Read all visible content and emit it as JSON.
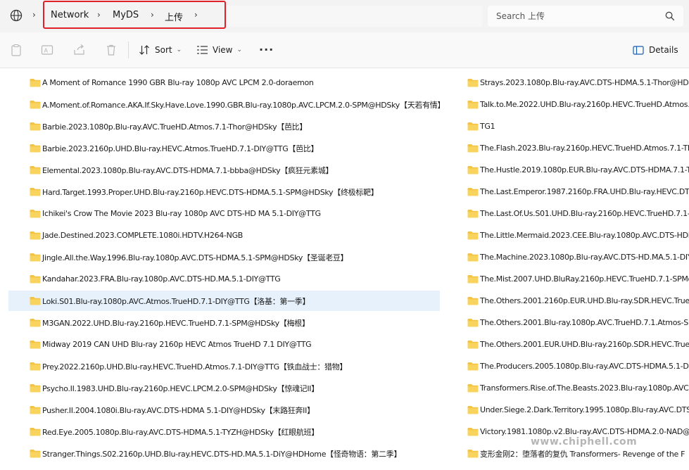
{
  "address_bar": {
    "breadcrumbs": [
      "Network",
      "MyDS",
      "上传"
    ]
  },
  "search": {
    "placeholder": "Search 上传"
  },
  "toolbar": {
    "sort_label": "Sort",
    "view_label": "View",
    "more_label": "···",
    "details_label": "Details"
  },
  "colors": {
    "folder": "#f4c342",
    "selection": "#e6f1fb",
    "highlight_border": "#e0202a"
  },
  "files_left": [
    "A Moment of Romance 1990 GBR Blu-ray 1080p AVC LPCM 2.0-doraemon",
    "A.Moment.of.Romance.AKA.If.Sky.Have.Love.1990.GBR.Blu-ray.1080p.AVC.LPCM.2.0-SPM@HDSky【天若有情】",
    "Barbie.2023.1080p.Blu-ray.AVC.TrueHD.Atmos.7.1-Thor@HDSky【芭比】",
    "Barbie.2023.2160p.UHD.Blu-ray.HEVC.Atmos.TrueHD.7.1-DIY@TTG【芭比】",
    "Elemental.2023.1080p.Blu-ray.AVC.DTS-HDMA.7.1-bbba@HDSky【疯狂元素城】",
    "Hard.Target.1993.Proper.UHD.Blu-ray.2160p.HEVC.DTS-HDMA.5.1-SPM@HDSky【终极标靶】",
    "Ichikei's Crow The Movie 2023 Blu-ray 1080p AVC DTS-HD MA 5.1-DIY@TTG",
    "Jade.Destined.2023.COMPLETE.1080i.HDTV.H264-NGB",
    "Jingle.All.the.Way.1996.Blu-ray.1080p.AVC.DTS-HDMA.5.1-SPM@HDSky【圣诞老豆】",
    "Kandahar.2023.FRA.Blu-ray.1080p.AVC.DTS-HD.MA.5.1-DIY@TTG",
    "Loki.S01.Blu-ray.1080p.AVC.Atmos.TrueHD.7.1-DIY@TTG【洛基：第一季】",
    "M3GAN.2022.UHD.Blu-ray.2160p.HEVC.TrueHD.7.1-SPM@HDSky【梅根】",
    "Midway 2019 CAN UHD Blu-ray 2160p HEVC Atmos TrueHD 7.1 DIY@TTG",
    "Prey.2022.2160p.UHD.Blu-ray.HEVC.TrueHD.Atmos.7.1-DIY@TTG【铁血战士：猎物】",
    "Psycho.II.1983.UHD.Blu-ray.2160p.HEVC.LPCM.2.0-SPM@HDSky【惊魂记II】",
    "Pusher.II.2004.1080i.Blu-ray.AVC.DTS-HDMA 5.1-DIY@HDSky【末路狂奔II】",
    "Red.Eye.2005.1080p.Blu-ray.AVC.DTS-HDMA.5.1-TYZH@HDSky【红眼航班】",
    "Stranger.Things.S02.2160p.UHD.Blu-ray.HEVC.DTS-HD.MA.5.1-DiY@HDHome【怪奇物语：第二季】"
  ],
  "files_right": [
    "Strays.2023.1080p.Blu-ray.AVC.DTS-HDMA.5.1-Thor@HDSky",
    "Talk.to.Me.2022.UHD.Blu-ray.2160p.HEVC.TrueHD.Atmos.7.1-",
    "TG1",
    "The.Flash.2023.Blu-ray.2160p.HEVC.TrueHD.Atmos.7.1-THDB",
    "The.Hustle.2019.1080p.EUR.Blu-ray.AVC.DTS-HDMA.7.1-TYZH",
    "The.Last.Emperor.1987.2160p.FRA.UHD.Blu-ray.HEVC.DTS-HD",
    "The.Last.Of.Us.S01.UHD.Blu-ray.2160p.HEVC.TrueHD.7.1-SPM",
    "The.Little.Mermaid.2023.CEE.Blu-ray.1080p.AVC.DTS-HDMA.7",
    "The.Machine.2023.1080p.Blu-ray.AVC.DTS-HD.MA.5.1-DIY@TT",
    "The.Mist.2007.UHD.BluRay.2160p.HEVC.TrueHD.7.1-SPM@HD",
    "The.Others.2001.2160p.EUR.UHD.Blu-ray.SDR.HEVC.TrueHD.A",
    "The.Others.2001.Blu-ray.1080p.AVC.TrueHD.7.1.Atmos-SPM@",
    "The.Others.2001.EUR.UHD.Blu-ray.2160p.SDR.HEVC.TrueHD.A",
    "The.Producers.2005.1080p.Blu-ray.AVC.DTS-HDMA.5.1-DIY@T",
    "Transformers.Rise.of.The.Beasts.2023.Blu-ray.1080p.AVC.True",
    "Under.Siege.2.Dark.Territory.1995.1080p.Blu-ray.AVC.DTS-HD",
    "Victory.1981.1080p.v2.Blu-ray.AVC.DTS-HDMA.2.0-NAD@HD",
    "变形金刚2：堕落者的复仇 Transformers- Revenge of the F"
  ],
  "selected_index_left": 10,
  "watermark": "www.chiphell.com"
}
